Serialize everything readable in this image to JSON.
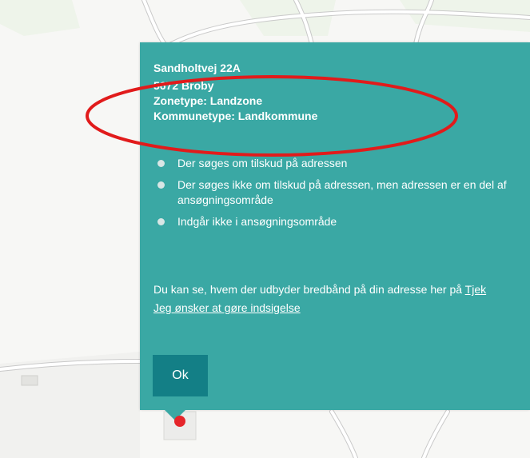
{
  "popup": {
    "street": "Sandholtvej 22A",
    "city": "5672 Broby",
    "zonetype": "Zonetype: Landzone",
    "kommunetype": "Kommunetype: Landkommune",
    "legend": [
      {
        "label": "Der søges om tilskud på adressen"
      },
      {
        "label": "Der søges ikke om tilskud på adressen, men adressen er en del af",
        "continuation": "ansøgningsområde"
      },
      {
        "label": "Indgår ikke i ansøgningsområde"
      }
    ],
    "info_text": "Du kan se, hvem der udbyder bredbånd på din adresse her på ",
    "info_link": "Tjek",
    "objection_link": "Jeg ønsker at gøre indsigelse",
    "ok_button": "Ok"
  },
  "colors": {
    "popup_bg": "#3aa8a4",
    "button_bg": "#137f86",
    "marker": "#e5252a",
    "annotation": "#e11b1b"
  },
  "icons": {
    "marker": "map-marker-icon"
  }
}
